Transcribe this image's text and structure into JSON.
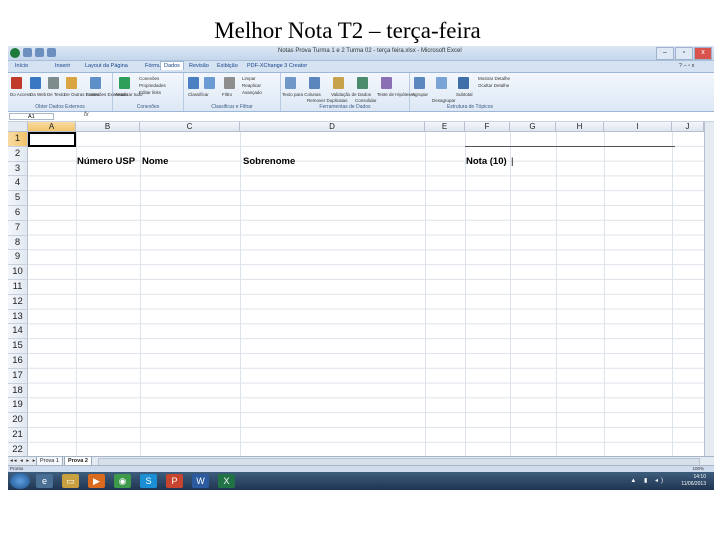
{
  "slide": {
    "title": "Melhor Nota T2 – terça-feira"
  },
  "window": {
    "title": "Notas Prova Turma 1 e 2 Turma 02 - terça feira.xlsx - Microsoft Excel",
    "controls": {
      "minimize": "–",
      "maximize": "▫",
      "close": "x"
    }
  },
  "ribbon": {
    "tabs": [
      "Início",
      "Inserir",
      "Layout da Página",
      "Fórmulas",
      "Dados",
      "Revisão",
      "Exibição",
      "PDF-XChange 3 Creator"
    ],
    "active_tab": "Dados",
    "groups": [
      {
        "label": "Obter Dados Externos",
        "items": [
          "Do Access",
          "Da Web",
          "De Texto",
          "De Outras Fontes",
          "Conexões Existentes"
        ]
      },
      {
        "label": "Conexões",
        "items": [
          "Atualizar tudo",
          "Conexões",
          "Propriedades",
          "Editar links"
        ]
      },
      {
        "label": "Classificar e Filtrar",
        "items": [
          "Classificar",
          "Filtro",
          "Limpar",
          "Reaplicar",
          "Avançado"
        ]
      },
      {
        "label": "Ferramentas de Dados",
        "items": [
          "Texto para Colunas",
          "Remover Duplicatas",
          "Validação de Dados",
          "Consolidar",
          "Teste de Hipóteses"
        ]
      },
      {
        "label": "Estrutura de Tópicos",
        "items": [
          "Agrupar",
          "Desagrupar",
          "Subtotal",
          "Mostrar Detalhe",
          "Ocultar Detalhe"
        ]
      }
    ]
  },
  "formula_bar": {
    "name_box": "A1",
    "fx": "fx",
    "content": ""
  },
  "sheet": {
    "columns": [
      "A",
      "B",
      "C",
      "D",
      "E",
      "F",
      "G",
      "H",
      "I",
      "J"
    ],
    "rows": [
      "1",
      "2",
      "3",
      "4",
      "5",
      "6",
      "7",
      "8",
      "9",
      "10",
      "11",
      "12",
      "13",
      "14",
      "15",
      "16",
      "17",
      "18",
      "19",
      "20",
      "21",
      "22"
    ],
    "selected_cell": "A1",
    "header_row": {
      "numero_usp": "Número USP",
      "nome": "Nome",
      "sobrenome": "Sobrenome",
      "nota": "Nota (10)",
      "cursor": "|"
    }
  },
  "sheet_tabs": {
    "nav": "◂◂ ◂ ▸ ▸▸",
    "tabs": [
      "Prova 1",
      "Prova 2"
    ],
    "active": "Prova 2"
  },
  "status_bar": {
    "status": "Pronto",
    "zoom": "100%"
  },
  "taskbar": {
    "tray_time": "14:10",
    "tray_date": "11/06/2013"
  },
  "colors": {
    "accent": "#15428b",
    "selected_header": "#f2c46b",
    "taskbar": "#1f3550"
  }
}
